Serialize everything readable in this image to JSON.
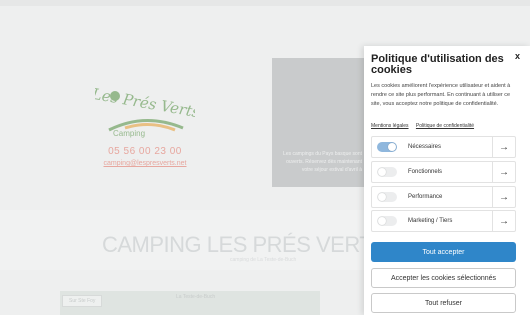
{
  "background": {
    "phone": "05 56 00 23 00",
    "email": "camping@lespresverts.net",
    "promo_lines": [
      "Les campings du Pays basque sont",
      "ouverts. Réservez dès maintenant",
      "votre séjour estival d'avril à"
    ],
    "hero_title": "CAMPING LES PRÉS VERTS",
    "hero_subtitle": "camping de La Teste-de-Buch",
    "map_tag": "Sur Ste Foy",
    "map_label": "La Teste-de-Buch",
    "logo_text": "Les Prés Verts",
    "logo_sub": "Camping"
  },
  "cookie_panel": {
    "title": "Politique d'utilisation des cookies",
    "close_label": "x",
    "description": "Les cookies améliorent l'expérience utilisateur et aident à rendre ce site plus performant. En continuant à utiliser ce site, vous acceptez notre politique de confidentialité.",
    "links": [
      "Mentions légales",
      "Politique de confidentialité"
    ],
    "categories": [
      {
        "label": "Nécessaires",
        "enabled": true
      },
      {
        "label": "Fonctionnels",
        "enabled": false
      },
      {
        "label": "Performance",
        "enabled": false
      },
      {
        "label": "Marketing / Tiers",
        "enabled": false
      }
    ],
    "accept_all": "Tout accepter",
    "accept_selected": "Accepter les cookies sélectionnés",
    "refuse_all": "Tout refuser"
  },
  "colors": {
    "accent": "#2f86c9",
    "toggle_on": "#8fb7dd",
    "logo_green": "#4f8d3e",
    "logo_orange": "#e69a2e"
  }
}
